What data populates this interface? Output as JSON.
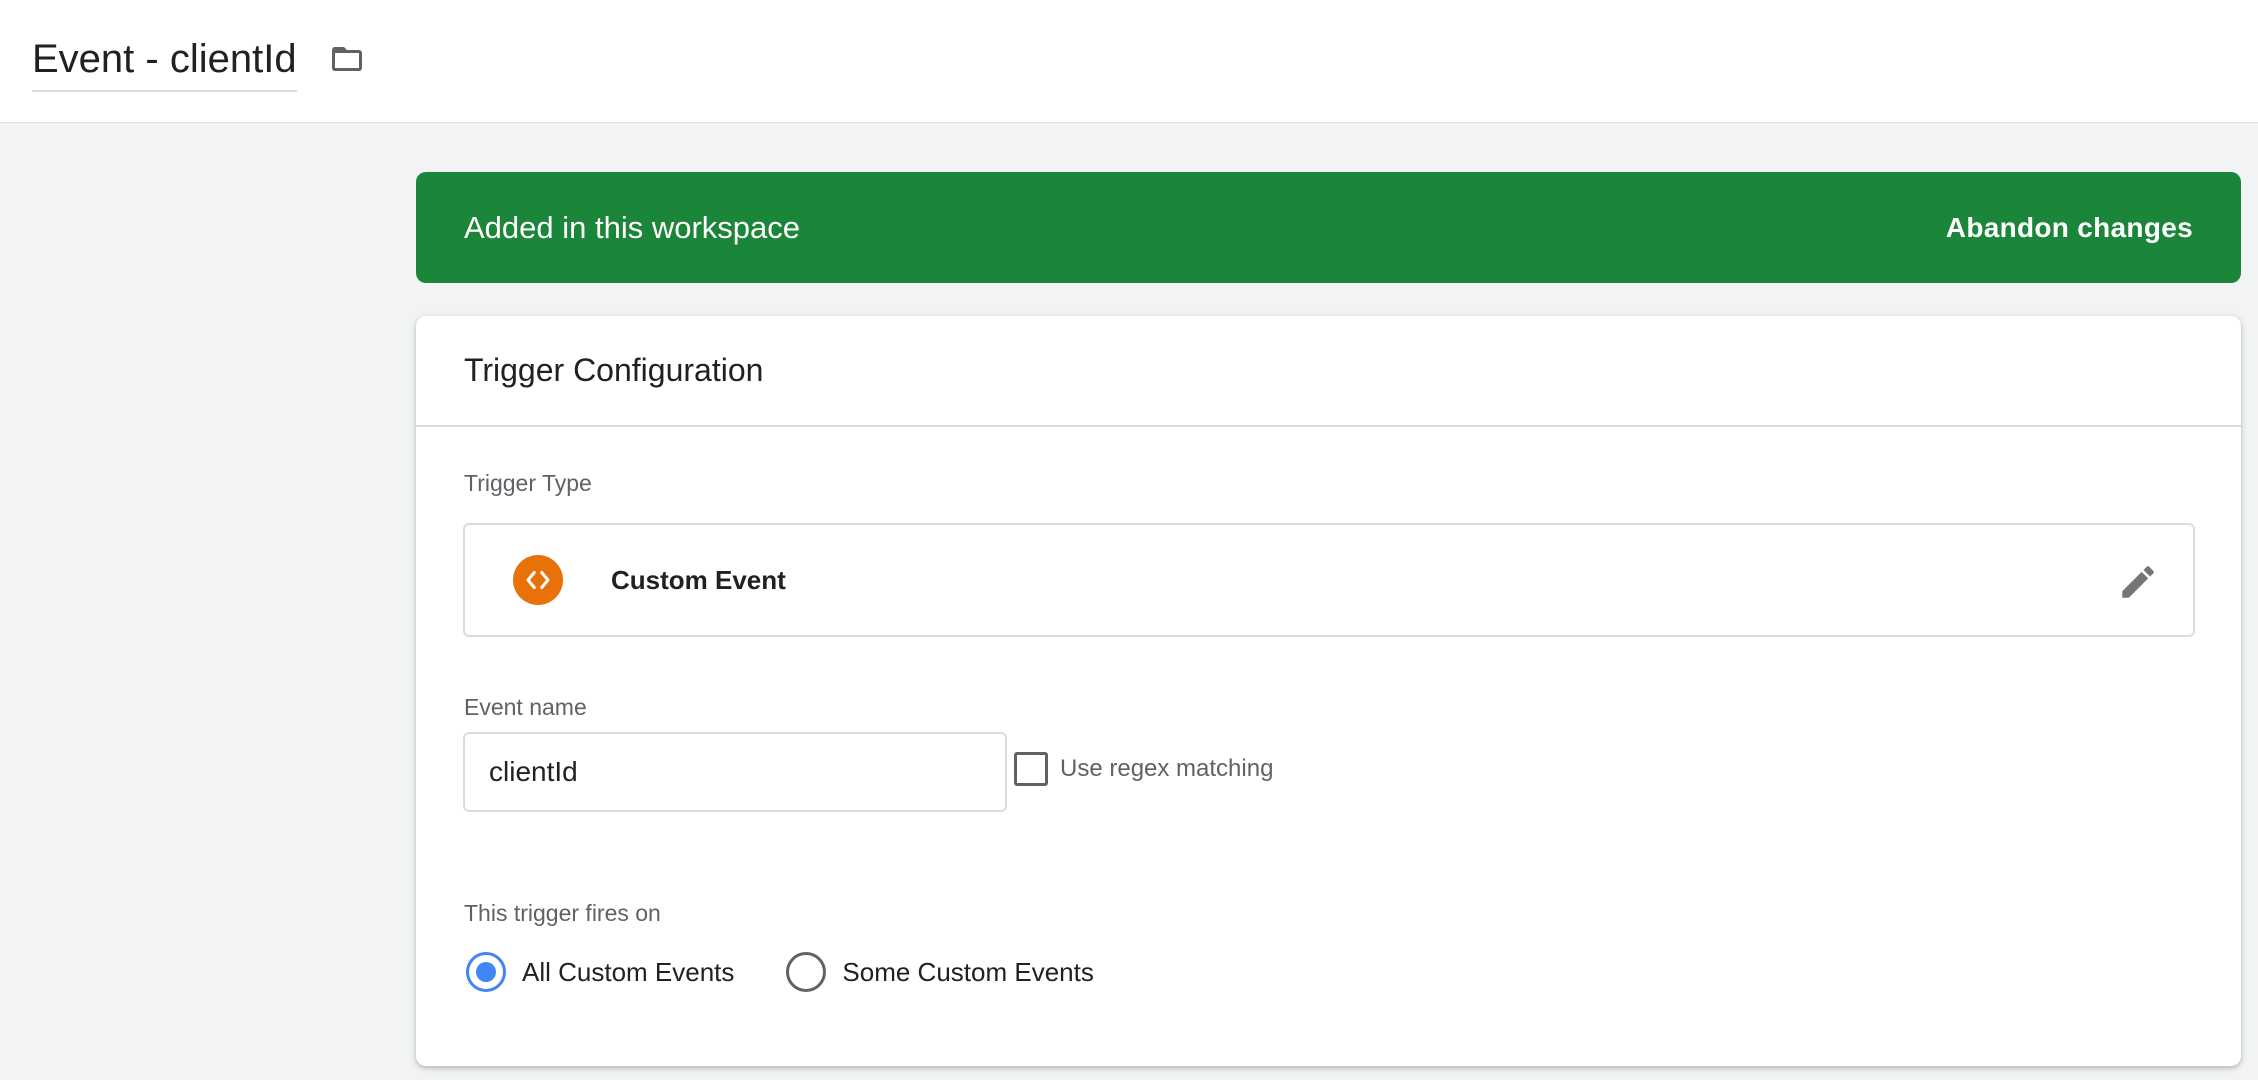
{
  "header": {
    "title": "Event - clientId",
    "folder_icon": "folder-icon"
  },
  "banner": {
    "text": "Added in this workspace",
    "action": "Abandon changes",
    "color": "#1b8539"
  },
  "card": {
    "title": "Trigger Configuration",
    "trigger_type": {
      "label": "Trigger Type",
      "name": "Custom Event",
      "icon": "code-brackets-icon",
      "icon_color": "#e8710a",
      "edit_icon": "pencil-icon"
    },
    "event_name": {
      "label": "Event name",
      "value": "clientId"
    },
    "regex": {
      "label": "Use regex matching",
      "checked": false
    },
    "fires_on": {
      "label": "This trigger fires on",
      "options": [
        {
          "label": "All Custom Events",
          "selected": true
        },
        {
          "label": "Some Custom Events",
          "selected": false
        }
      ]
    }
  }
}
